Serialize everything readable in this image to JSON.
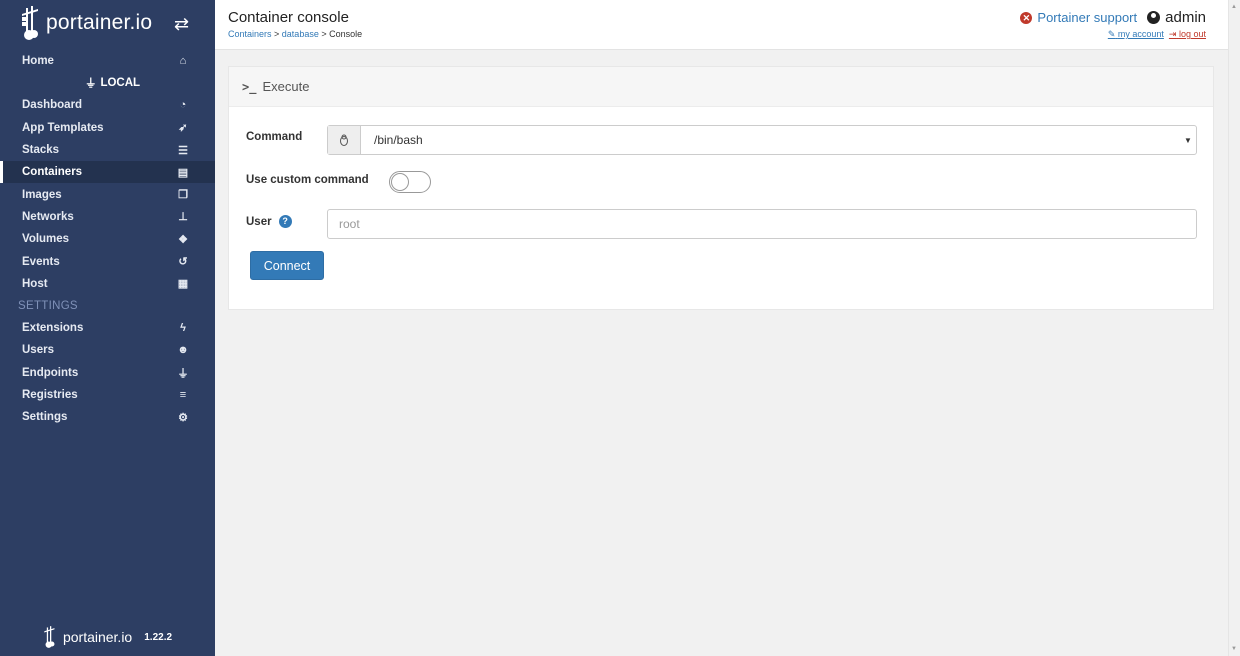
{
  "sidebar": {
    "brand": "portainer.io",
    "home": {
      "label": "Home",
      "icon": "home-icon"
    },
    "endpoint": "LOCAL",
    "items": [
      {
        "label": "Dashboard",
        "icon": "tachometer-icon"
      },
      {
        "label": "App Templates",
        "icon": "rocket-icon"
      },
      {
        "label": "Stacks",
        "icon": "th-list-icon"
      },
      {
        "label": "Containers",
        "icon": "server-icon"
      },
      {
        "label": "Images",
        "icon": "clone-icon"
      },
      {
        "label": "Networks",
        "icon": "sitemap-icon"
      },
      {
        "label": "Volumes",
        "icon": "cubes-icon"
      },
      {
        "label": "Events",
        "icon": "history-icon"
      },
      {
        "label": "Host",
        "icon": "th-icon"
      }
    ],
    "settings_section": "SETTINGS",
    "settings_items": [
      {
        "label": "Extensions",
        "icon": "bolt-icon"
      },
      {
        "label": "Users",
        "icon": "users-icon"
      },
      {
        "label": "Endpoints",
        "icon": "plug-icon"
      },
      {
        "label": "Registries",
        "icon": "database-icon"
      },
      {
        "label": "Settings",
        "icon": "cogs-icon"
      }
    ],
    "active": "Containers",
    "footer": {
      "brand": "portainer.io",
      "version": "1.22.2"
    }
  },
  "header": {
    "title": "Container console",
    "breadcrumb": {
      "part1": "Containers",
      "sep1": " > ",
      "part2": "database",
      "sep2": " > ",
      "current": "Console"
    },
    "support_label": "Portainer support",
    "username": "admin",
    "my_account": "my account",
    "logout": "log out"
  },
  "panel": {
    "heading": "Execute",
    "command_label": "Command",
    "command_value": "/bin/bash",
    "custom_label": "Use custom command",
    "custom_enabled": false,
    "user_label": "User",
    "user_placeholder": "root",
    "connect_label": "Connect"
  },
  "colors": {
    "sidebar_bg": "#2d3e63",
    "primary": "#337ab7",
    "danger": "#c0392b"
  }
}
